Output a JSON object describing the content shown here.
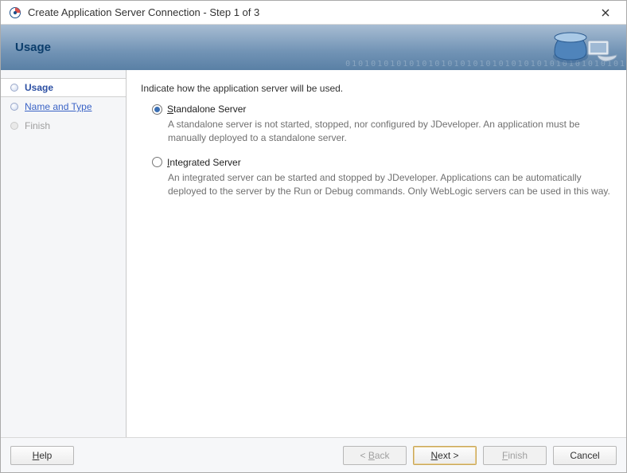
{
  "window": {
    "title": "Create Application Server Connection - Step 1 of 3"
  },
  "banner": {
    "title": "Usage"
  },
  "sidebar": {
    "items": [
      {
        "label": "Usage"
      },
      {
        "label": "Name and Type"
      },
      {
        "label": "Finish"
      }
    ]
  },
  "content": {
    "intro": "Indicate how  the application server will be used.",
    "options": [
      {
        "label_pre": "",
        "mnemonic": "S",
        "label_post": "tandalone Server",
        "desc": "A standalone server is not started, stopped, nor configured by JDeveloper. An application must be manually deployed to a standalone server.",
        "selected": true
      },
      {
        "label_pre": "",
        "mnemonic": "I",
        "label_post": "ntegrated Server",
        "desc": "An integrated server can be started and stopped by JDeveloper. Applications can be automatically deployed to the server by the Run or Debug commands. Only WebLogic servers can be used in this way.",
        "selected": false
      }
    ]
  },
  "footer": {
    "help_mn": "H",
    "help_post": "elp",
    "back_pre": "< ",
    "back_mn": "B",
    "back_post": "ack",
    "next_mn": "N",
    "next_post": "ext >",
    "finish_pre": "",
    "finish_mn": "F",
    "finish_post": "inish",
    "cancel": "Cancel"
  }
}
